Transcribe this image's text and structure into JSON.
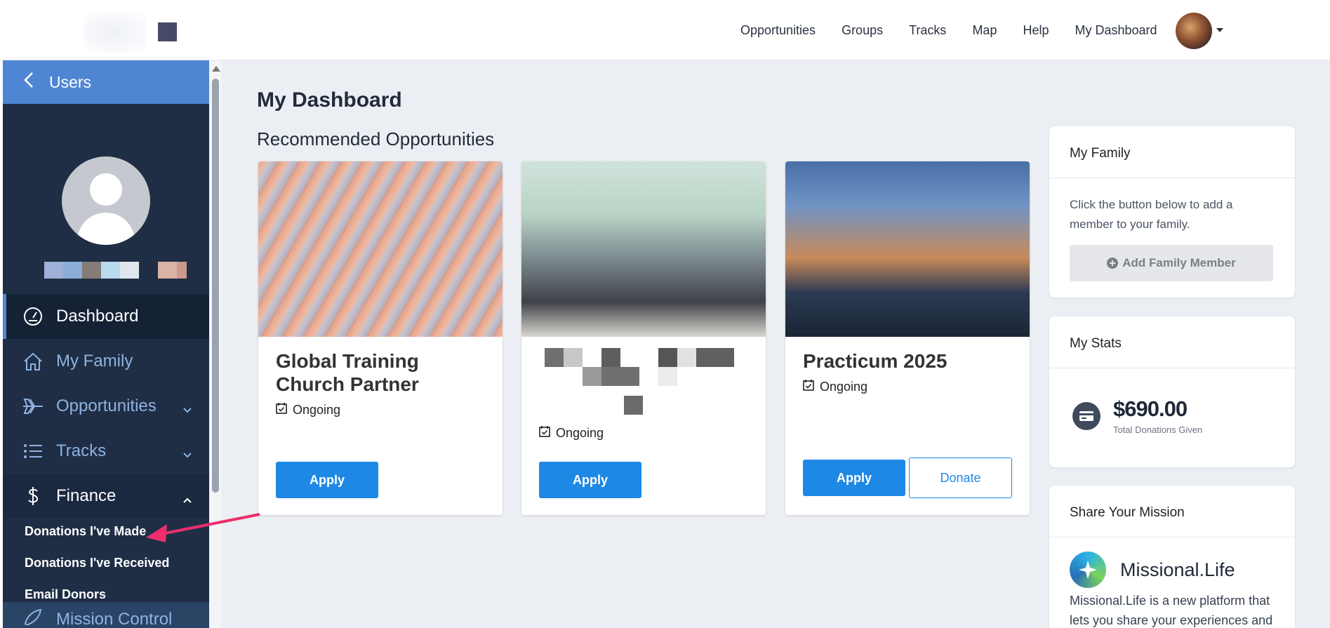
{
  "nav": {
    "items": [
      "Opportunities",
      "Groups",
      "Tracks",
      "Map",
      "Help",
      "My Dashboard"
    ]
  },
  "sidebar": {
    "back_label": "Users",
    "items": [
      {
        "label": "Dashboard",
        "icon": "dashboard-gauge-icon"
      },
      {
        "label": "My Family",
        "icon": "home-icon"
      },
      {
        "label": "Opportunities",
        "icon": "plane-icon"
      },
      {
        "label": "Tracks",
        "icon": "list-icon"
      },
      {
        "label": "Finance",
        "icon": "dollar-icon"
      }
    ],
    "finance_sub": [
      "Donations I've Made",
      "Donations I've Received",
      "Email Donors"
    ],
    "bottom_label": "Mission Control"
  },
  "main": {
    "title": "My Dashboard",
    "section": "Recommended Opportunities",
    "cards": [
      {
        "title": "Global Training Church Partner",
        "status": "Ongoing",
        "apply": "Apply"
      },
      {
        "title": "",
        "status": "Ongoing",
        "apply": "Apply"
      },
      {
        "title": "Practicum 2025",
        "status": "Ongoing",
        "apply": "Apply",
        "donate": "Donate"
      }
    ]
  },
  "family": {
    "heading": "My Family",
    "text": "Click the button below to add a member to your family.",
    "button": "Add Family Member"
  },
  "stats": {
    "heading": "My Stats",
    "value": "$690.00",
    "label": "Total Donations Given"
  },
  "share": {
    "heading": "Share Your Mission",
    "brand": "Missional.Life",
    "text": "Missional.Life is a new platform that lets you share your experiences and"
  },
  "colors": {
    "accent": "#1e88e5",
    "sidebar_bg": "#1f2e45",
    "sidebar_header": "#4f86d4",
    "annotation_arrow": "#ee2e6b"
  }
}
